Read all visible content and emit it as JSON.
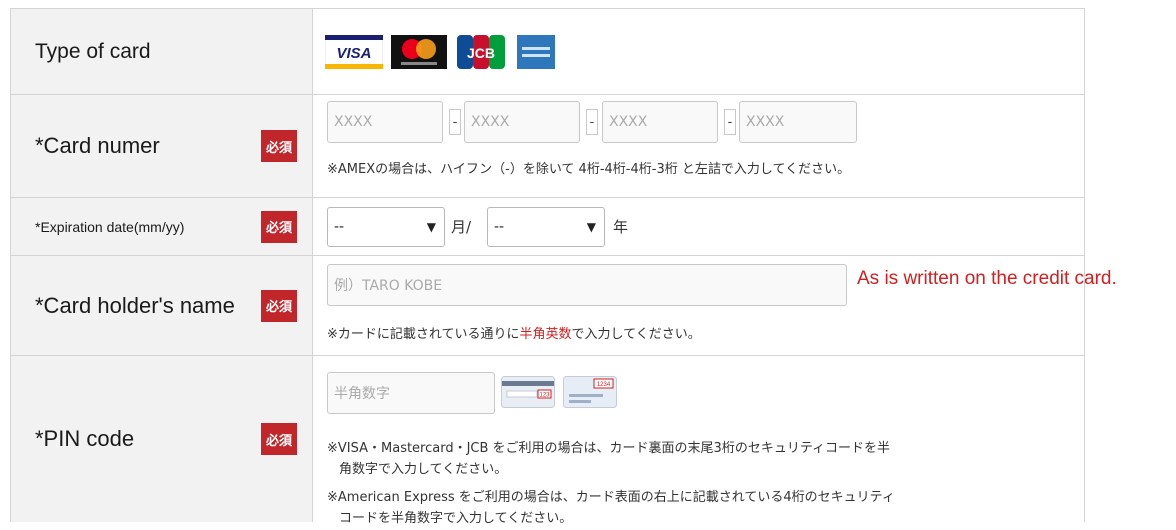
{
  "required_badge": "必須",
  "type_of_card": {
    "label": "Type of card",
    "logos": [
      {
        "name": "VISA",
        "icon": "visa-logo"
      },
      {
        "name": "Mastercard",
        "icon": "mastercard-logo"
      },
      {
        "name": "JCB",
        "icon": "jcb-logo"
      },
      {
        "name": "AMEX",
        "icon": "amex-logo"
      }
    ]
  },
  "card_number": {
    "label": "*Card numer",
    "placeholders": [
      "XXXX",
      "XXXX",
      "XXXX",
      "XXXX"
    ],
    "separator": "-",
    "note": "※AMEXの場合は、ハイフン（-）を除いて 4桁-4桁-4桁-3桁 と左詰で入力してください。"
  },
  "expiration": {
    "label": "*Expiration date(mm/yy)",
    "month_value": "--",
    "month_unit": "月/",
    "year_value": "--",
    "year_unit": "年"
  },
  "holder": {
    "label": "*Card holder's name",
    "placeholder": "例）TARO KOBE",
    "annotation": "As is written on the credit card.",
    "note_before": "※カードに記載されている通りに",
    "note_highlight": "半角英数",
    "note_after": "で入力してください。"
  },
  "pin": {
    "label": "*PIN code",
    "placeholder": "半角数字",
    "card_back_code": "123",
    "card_front_code": "1234",
    "note1_line1": "※VISA・Mastercard・JCB をご利用の場合は、カード裏面の末尾3桁のセキュリティコードを半",
    "note1_line2": "角数字で入力してください。",
    "note2_line1": "※American Express をご利用の場合は、カード表面の右上に記載されている4桁のセキュリティ",
    "note2_line2": "コードを半角数字で入力してください。"
  },
  "colors": {
    "required": "#c0262a",
    "annotation": "#d21f1f",
    "label_bg": "#f2f2f2"
  }
}
